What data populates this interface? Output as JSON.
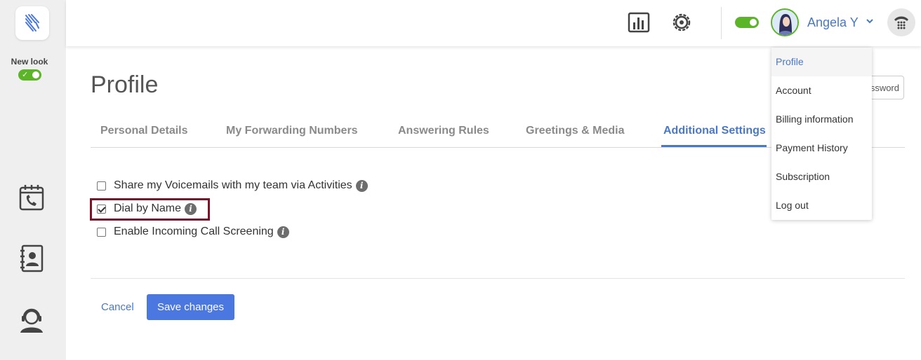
{
  "sidebar": {
    "new_look_label": "New look",
    "items": [
      {
        "icon": "calendar-phone-icon"
      },
      {
        "icon": "contacts-book-icon"
      },
      {
        "icon": "agent-headset-icon"
      }
    ]
  },
  "topbar": {
    "icons": [
      "analytics-icon",
      "settings-icon"
    ],
    "user_name": "Angela Y"
  },
  "page": {
    "title": "Profile",
    "password_button": "ssword"
  },
  "tabs": [
    {
      "label": "Personal Details",
      "active": false
    },
    {
      "label": "My Forwarding Numbers",
      "active": false
    },
    {
      "label": "Answering Rules",
      "active": false
    },
    {
      "label": "Greetings & Media",
      "active": false
    },
    {
      "label": "Additional Settings",
      "active": true
    }
  ],
  "options": [
    {
      "label": "Share my Voicemails with my team via Activities",
      "checked": false
    },
    {
      "label": "Dial by Name",
      "checked": true
    },
    {
      "label": "Enable Incoming Call Screening",
      "checked": false
    }
  ],
  "actions": {
    "cancel": "Cancel",
    "save": "Save changes"
  },
  "user_menu": [
    {
      "label": "Profile",
      "active": true
    },
    {
      "label": "Account"
    },
    {
      "label": "Billing information"
    },
    {
      "label": "Payment History"
    },
    {
      "label": "Subscription"
    },
    {
      "label": "Log out"
    }
  ],
  "colors": {
    "accent": "#4a78c2",
    "button": "#4a78e0",
    "toggle_on": "#5cb528",
    "highlight": "#7a1228"
  }
}
